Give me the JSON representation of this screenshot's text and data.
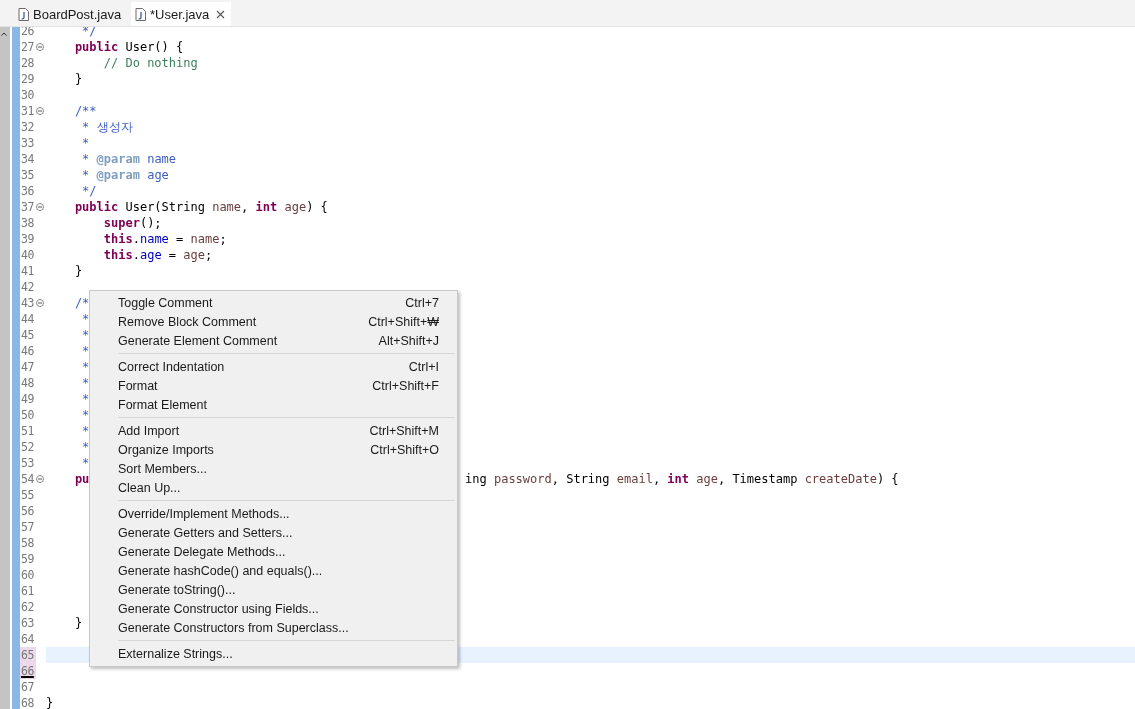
{
  "tabs": [
    {
      "label": "BoardPost.java",
      "selected": false,
      "closable": false
    },
    {
      "label": "*User.java",
      "selected": true,
      "closable": true
    }
  ],
  "lines": [
    {
      "n": "26",
      "fold": false,
      "current": false,
      "changed": false,
      "underlined": false,
      "tokens": [
        {
          "kind": "javadoc",
          "text": "     */"
        }
      ]
    },
    {
      "n": "27",
      "fold": true,
      "current": false,
      "changed": false,
      "underlined": false,
      "tokens": [
        {
          "kind": "keyword",
          "text": "    public"
        },
        {
          "kind": "plain",
          "text": " User() {"
        }
      ]
    },
    {
      "n": "28",
      "fold": false,
      "current": false,
      "changed": false,
      "underlined": false,
      "tokens": [
        {
          "kind": "comment",
          "text": "        // Do nothing"
        }
      ]
    },
    {
      "n": "29",
      "fold": false,
      "current": false,
      "changed": false,
      "underlined": false,
      "tokens": [
        {
          "kind": "plain",
          "text": "    }"
        }
      ]
    },
    {
      "n": "30",
      "fold": false,
      "current": false,
      "changed": false,
      "underlined": false
    },
    {
      "n": "31",
      "fold": true,
      "current": false,
      "changed": false,
      "underlined": false,
      "tokens": [
        {
          "kind": "javadoc",
          "text": "    /**"
        }
      ]
    },
    {
      "n": "32",
      "fold": false,
      "current": false,
      "changed": false,
      "underlined": false,
      "tokens": [
        {
          "kind": "javadoc",
          "text": "     * 생성자"
        }
      ]
    },
    {
      "n": "33",
      "fold": false,
      "current": false,
      "changed": false,
      "underlined": false,
      "tokens": [
        {
          "kind": "javadoc",
          "text": "     *"
        }
      ]
    },
    {
      "n": "34",
      "fold": false,
      "current": false,
      "changed": false,
      "underlined": false,
      "tokens": [
        {
          "kind": "javadoc",
          "text": "     * "
        },
        {
          "kind": "tag",
          "text": "@param"
        },
        {
          "kind": "javadoc",
          "text": " name"
        }
      ]
    },
    {
      "n": "35",
      "fold": false,
      "current": false,
      "changed": false,
      "underlined": false,
      "tokens": [
        {
          "kind": "javadoc",
          "text": "     * "
        },
        {
          "kind": "tag",
          "text": "@param"
        },
        {
          "kind": "javadoc",
          "text": " age"
        }
      ]
    },
    {
      "n": "36",
      "fold": false,
      "current": false,
      "changed": false,
      "underlined": false,
      "tokens": [
        {
          "kind": "javadoc",
          "text": "     */"
        }
      ]
    },
    {
      "n": "37",
      "fold": true,
      "current": false,
      "changed": false,
      "underlined": false,
      "tokens": [
        {
          "kind": "keyword",
          "text": "    public"
        },
        {
          "kind": "plain",
          "text": " User(String "
        },
        {
          "kind": "param",
          "text": "name"
        },
        {
          "kind": "plain",
          "text": ", "
        },
        {
          "kind": "keyword",
          "text": "int"
        },
        {
          "kind": "param",
          "text": " age"
        },
        {
          "kind": "plain",
          "text": ") {"
        }
      ]
    },
    {
      "n": "38",
      "fold": false,
      "current": false,
      "changed": false,
      "underlined": false,
      "tokens": [
        {
          "kind": "keyword",
          "text": "        super"
        },
        {
          "kind": "plain",
          "text": "();"
        }
      ]
    },
    {
      "n": "39",
      "fold": false,
      "current": false,
      "changed": false,
      "underlined": false,
      "tokens": [
        {
          "kind": "keyword",
          "text": "        this"
        },
        {
          "kind": "plain",
          "text": "."
        },
        {
          "kind": "field",
          "text": "name"
        },
        {
          "kind": "plain",
          "text": " = "
        },
        {
          "kind": "param",
          "text": "name"
        },
        {
          "kind": "plain",
          "text": ";"
        }
      ]
    },
    {
      "n": "40",
      "fold": false,
      "current": false,
      "changed": false,
      "underlined": false,
      "tokens": [
        {
          "kind": "keyword",
          "text": "        this"
        },
        {
          "kind": "plain",
          "text": "."
        },
        {
          "kind": "field",
          "text": "age"
        },
        {
          "kind": "plain",
          "text": " = "
        },
        {
          "kind": "param",
          "text": "age"
        },
        {
          "kind": "plain",
          "text": ";"
        }
      ]
    },
    {
      "n": "41",
      "fold": false,
      "current": false,
      "changed": false,
      "underlined": false,
      "tokens": [
        {
          "kind": "plain",
          "text": "    }"
        }
      ]
    },
    {
      "n": "42",
      "fold": false,
      "current": false,
      "changed": false,
      "underlined": false
    },
    {
      "n": "43",
      "fold": true,
      "current": false,
      "changed": false,
      "underlined": false,
      "tokens": [
        {
          "kind": "javadoc",
          "text": "    /*"
        }
      ]
    },
    {
      "n": "44",
      "fold": false,
      "current": false,
      "changed": false,
      "underlined": false,
      "tokens": [
        {
          "kind": "javadoc",
          "text": "     *"
        }
      ]
    },
    {
      "n": "45",
      "fold": false,
      "current": false,
      "changed": false,
      "underlined": false,
      "tokens": [
        {
          "kind": "javadoc",
          "text": "     *"
        }
      ]
    },
    {
      "n": "46",
      "fold": false,
      "current": false,
      "changed": false,
      "underlined": false,
      "tokens": [
        {
          "kind": "javadoc",
          "text": "     *"
        }
      ]
    },
    {
      "n": "47",
      "fold": false,
      "current": false,
      "changed": false,
      "underlined": false,
      "tokens": [
        {
          "kind": "javadoc",
          "text": "     *"
        }
      ]
    },
    {
      "n": "48",
      "fold": false,
      "current": false,
      "changed": false,
      "underlined": false,
      "tokens": [
        {
          "kind": "javadoc",
          "text": "     *"
        }
      ]
    },
    {
      "n": "49",
      "fold": false,
      "current": false,
      "changed": false,
      "underlined": false,
      "tokens": [
        {
          "kind": "javadoc",
          "text": "     *"
        }
      ]
    },
    {
      "n": "50",
      "fold": false,
      "current": false,
      "changed": false,
      "underlined": false,
      "tokens": [
        {
          "kind": "javadoc",
          "text": "     *"
        }
      ]
    },
    {
      "n": "51",
      "fold": false,
      "current": false,
      "changed": false,
      "underlined": false,
      "tokens": [
        {
          "kind": "javadoc",
          "text": "     *"
        }
      ]
    },
    {
      "n": "52",
      "fold": false,
      "current": false,
      "changed": false,
      "underlined": false,
      "tokens": [
        {
          "kind": "javadoc",
          "text": "     *"
        }
      ]
    },
    {
      "n": "53",
      "fold": false,
      "current": false,
      "changed": false,
      "underlined": false,
      "tokens": [
        {
          "kind": "javadoc",
          "text": "     *"
        }
      ]
    },
    {
      "n": "54",
      "fold": true,
      "current": false,
      "changed": false,
      "underlined": false,
      "tokens": [
        {
          "kind": "keyword",
          "text": "    pu"
        },
        {
          "kind": "gap"
        },
        {
          "kind": "plain",
          "text": "ing "
        },
        {
          "kind": "param",
          "text": "password"
        },
        {
          "kind": "plain",
          "text": ", String "
        },
        {
          "kind": "param",
          "text": "email"
        },
        {
          "kind": "plain",
          "text": ", "
        },
        {
          "kind": "keyword",
          "text": "int"
        },
        {
          "kind": "param",
          "text": " age"
        },
        {
          "kind": "plain",
          "text": ", Timestamp "
        },
        {
          "kind": "param",
          "text": "createDate"
        },
        {
          "kind": "plain",
          "text": ") {"
        }
      ]
    },
    {
      "n": "55",
      "fold": false,
      "current": false,
      "changed": false,
      "underlined": false
    },
    {
      "n": "56",
      "fold": false,
      "current": false,
      "changed": false,
      "underlined": false
    },
    {
      "n": "57",
      "fold": false,
      "current": false,
      "changed": false,
      "underlined": false
    },
    {
      "n": "58",
      "fold": false,
      "current": false,
      "changed": false,
      "underlined": false
    },
    {
      "n": "59",
      "fold": false,
      "current": false,
      "changed": false,
      "underlined": false
    },
    {
      "n": "60",
      "fold": false,
      "current": false,
      "changed": false,
      "underlined": false
    },
    {
      "n": "61",
      "fold": false,
      "current": false,
      "changed": false,
      "underlined": false
    },
    {
      "n": "62",
      "fold": false,
      "current": false,
      "changed": false,
      "underlined": false
    },
    {
      "n": "63",
      "fold": false,
      "current": false,
      "changed": false,
      "underlined": false,
      "tokens": [
        {
          "kind": "plain",
          "text": "    }"
        }
      ]
    },
    {
      "n": "64",
      "fold": false,
      "current": false,
      "changed": false,
      "underlined": false
    },
    {
      "n": "65",
      "fold": false,
      "current": true,
      "changed": true,
      "underlined": false
    },
    {
      "n": "66",
      "fold": false,
      "current": false,
      "changed": true,
      "underlined": true
    },
    {
      "n": "67",
      "fold": false,
      "current": false,
      "changed": false,
      "underlined": false
    },
    {
      "n": "68",
      "fold": false,
      "current": false,
      "changed": false,
      "underlined": false,
      "tokens": [
        {
          "kind": "plain",
          "text": "}"
        }
      ]
    }
  ],
  "context_menu": {
    "groups": [
      [
        {
          "label": "Toggle Comment",
          "shortcut": "Ctrl+7"
        },
        {
          "label": "Remove Block Comment",
          "shortcut": "Ctrl+Shift+₩"
        },
        {
          "label": "Generate Element Comment",
          "shortcut": "Alt+Shift+J"
        }
      ],
      [
        {
          "label": "Correct Indentation",
          "shortcut": "Ctrl+I"
        },
        {
          "label": "Format",
          "shortcut": "Ctrl+Shift+F"
        },
        {
          "label": "Format Element"
        }
      ],
      [
        {
          "label": "Add Import",
          "shortcut": "Ctrl+Shift+M"
        },
        {
          "label": "Organize Imports",
          "shortcut": "Ctrl+Shift+O"
        },
        {
          "label": "Sort Members..."
        },
        {
          "label": "Clean Up..."
        }
      ],
      [
        {
          "label": "Override/Implement Methods..."
        },
        {
          "label": "Generate Getters and Setters..."
        },
        {
          "label": "Generate Delegate Methods..."
        },
        {
          "label": "Generate hashCode() and equals()..."
        },
        {
          "label": "Generate toString()..."
        },
        {
          "label": "Generate Constructor using Fields..."
        },
        {
          "label": "Generate Constructors from Superclass..."
        }
      ],
      [
        {
          "label": "Externalize Strings..."
        }
      ]
    ]
  }
}
